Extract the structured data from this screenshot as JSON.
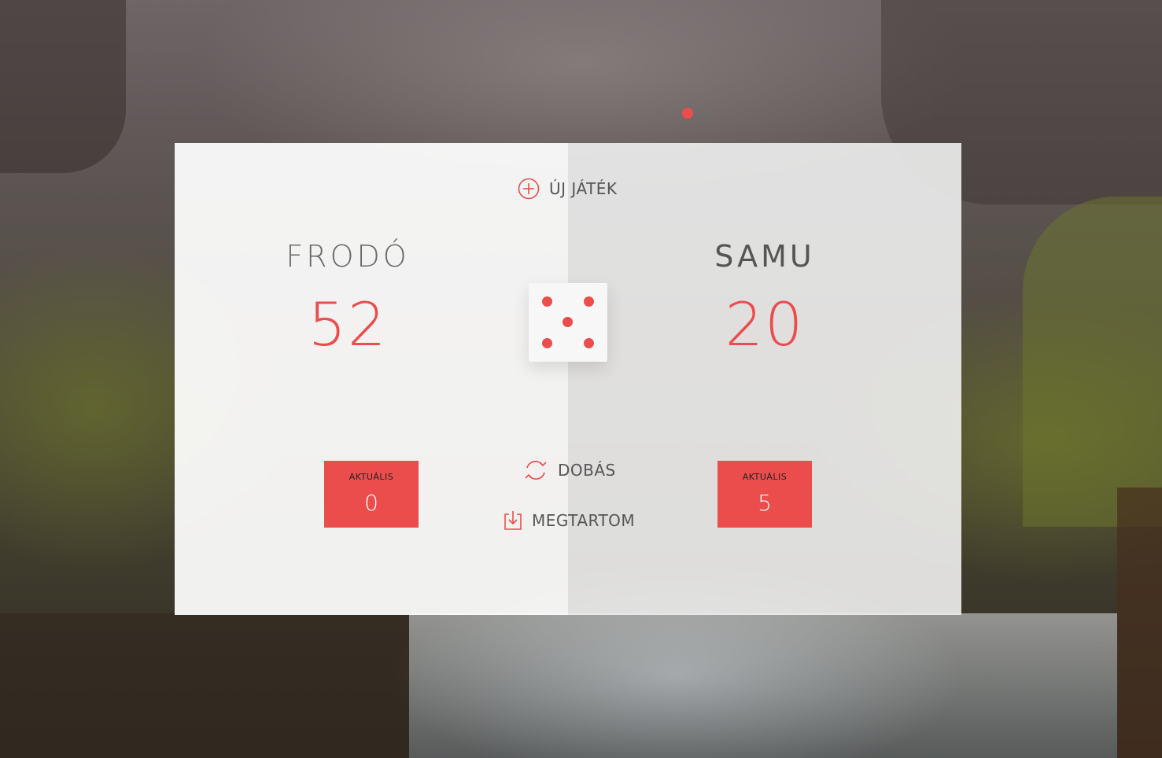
{
  "colors": {
    "accent": "#eb4d4d",
    "panel_left": "#ffffff",
    "panel_right": "#f0f0f0"
  },
  "controls": {
    "new_game": {
      "label": "ÚJ JÁTÉK",
      "icon": "plus-circle-icon"
    },
    "roll": {
      "label": "DOBÁS",
      "icon": "refresh-icon"
    },
    "hold": {
      "label": "MEGTARTOM",
      "icon": "download-icon"
    }
  },
  "players": [
    {
      "name": "FRODÓ",
      "score": "52",
      "current_label": "AKTUÁLIS",
      "current_value": "0",
      "active": false
    },
    {
      "name": "SAMU",
      "score": "20",
      "current_label": "AKTUÁLIS",
      "current_value": "5",
      "active": true
    }
  ],
  "dice": {
    "value": 5
  }
}
